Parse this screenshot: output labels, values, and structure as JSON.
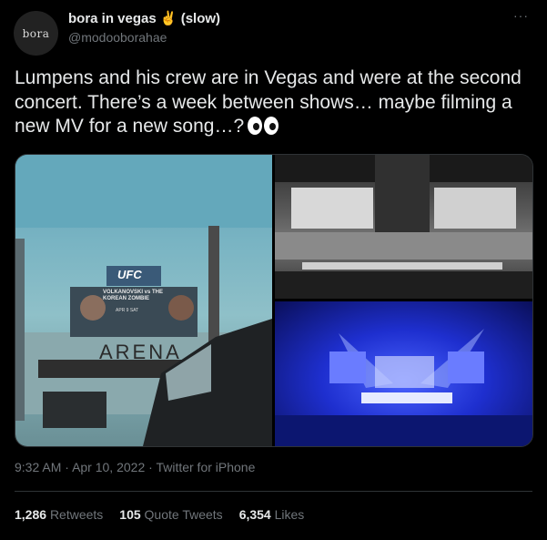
{
  "user": {
    "avatar_text": "bora",
    "display_name": "bora in vegas ✌️ (slow)",
    "handle": "@modooborahae"
  },
  "more_icon": "···",
  "tweet": {
    "text": "Lumpens and his crew are in Vegas and were at the second concert. There’s a week between shows… maybe filming a new MV for a new song…?",
    "emoji": "eyes-emoji"
  },
  "media": {
    "left_image": {
      "billboard_brand": "UFC",
      "billboard_text": "VOLKANOVSKI vs THE KOREAN ZOMBIE",
      "billboard_date": "APR 9 SAT",
      "sign_text": "ARENA"
    },
    "top_right_image": {
      "subject": "concert-stage-grayscale"
    },
    "bottom_right_image": {
      "subject": "concert-stage-blue"
    }
  },
  "meta": {
    "time": "9:32 AM",
    "separator": "·",
    "date": "Apr 10, 2022",
    "source": "Twitter for iPhone"
  },
  "stats": {
    "retweets_count": "1,286",
    "retweets_label": "Retweets",
    "quotes_count": "105",
    "quotes_label": "Quote Tweets",
    "likes_count": "6,354",
    "likes_label": "Likes"
  },
  "colors": {
    "background": "#000000",
    "text": "#e7e9ea",
    "secondary": "#71767b",
    "divider": "#2f3336"
  }
}
